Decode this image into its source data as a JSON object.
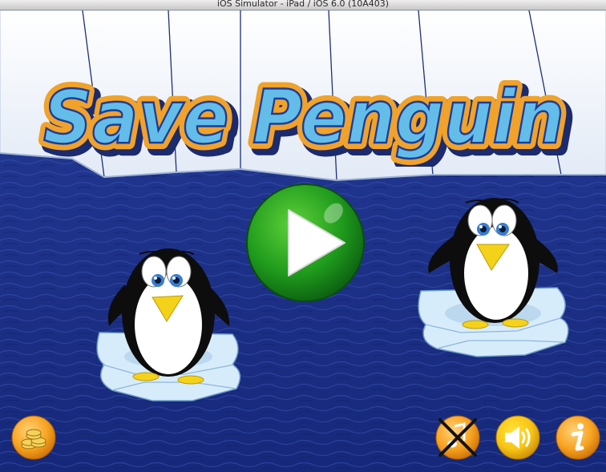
{
  "window": {
    "title": "iOS Simulator - iPad / iOS 6.0 (10A403)"
  },
  "game": {
    "title_text": "Save Penguin",
    "colors": {
      "ocean": "#1d318c",
      "ice_wall": "#f1f5fb",
      "title_fill": "#63bde8",
      "title_outline": "#f0a22b",
      "play_button": "#1f9a1c",
      "orange_button": "#f7a320"
    },
    "buttons": {
      "play": "play-icon",
      "shop": "coins-icon",
      "music_off": "music-muted-icon",
      "sound": "speaker-icon",
      "info": "info-icon"
    }
  }
}
